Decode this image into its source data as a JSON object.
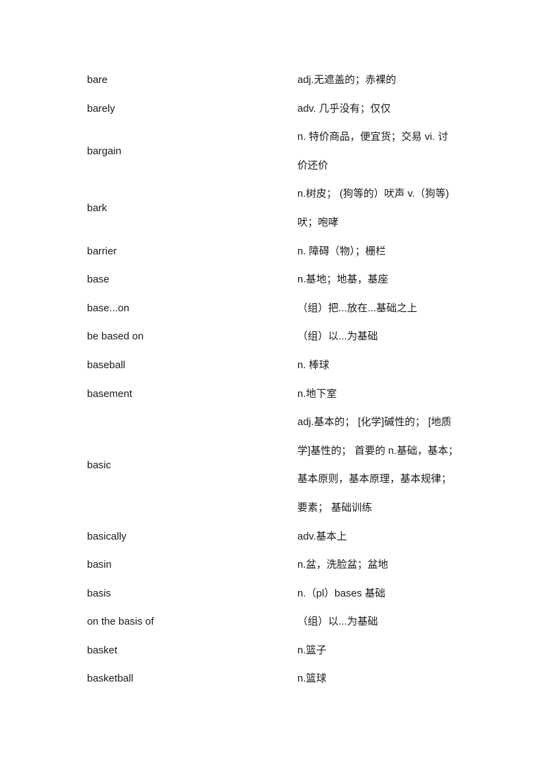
{
  "entries": [
    {
      "word": "bare",
      "definition_lines": [
        "adj.无遮盖的；赤裸的"
      ]
    },
    {
      "word": "barely",
      "definition_lines": [
        "adv. 几乎没有；仅仅"
      ]
    },
    {
      "word": "bargain",
      "definition_lines": [
        "n. 特价商品，便宜货；交易  vi. 讨",
        "价还价"
      ]
    },
    {
      "word": "bark",
      "definition_lines": [
        "n.树皮；  (狗等的）吠声 v.（狗等)",
        "吠；咆哮"
      ]
    },
    {
      "word": "barrier",
      "definition_lines": [
        "n. 障碍（物）；栅栏"
      ]
    },
    {
      "word": "base",
      "definition_lines": [
        "n.基地；地基，基座"
      ]
    },
    {
      "word": "base...on",
      "definition_lines": [
        " （组）把...放在...基础之上"
      ]
    },
    {
      "word": "be based on",
      "definition_lines": [
        " （组）以...为基础"
      ]
    },
    {
      "word": "baseball",
      "definition_lines": [
        "n. 棒球"
      ]
    },
    {
      "word": "basement",
      "definition_lines": [
        "n.地下室"
      ]
    },
    {
      "word": "basic",
      "definition_lines": [
        "adj.基本的；  [化学]碱性的；  [地质",
        "学]基性的；  首要的  n.基础，基本；",
        "基本原则，基本原理，基本规律；",
        "要素；  基础训练"
      ]
    },
    {
      "word": "basically",
      "definition_lines": [
        "adv.基本上"
      ]
    },
    {
      "word": "basin",
      "definition_lines": [
        "n.盆，洗脸盆；盆地"
      ]
    },
    {
      "word": "basis",
      "definition_lines": [
        "n.（pl）bases  基础"
      ]
    },
    {
      "word": "on the basis of",
      "definition_lines": [
        " （组）以...为基础"
      ]
    },
    {
      "word": "basket",
      "definition_lines": [
        "n.篮子"
      ]
    },
    {
      "word": "basketball",
      "definition_lines": [
        "n.篮球"
      ]
    }
  ]
}
